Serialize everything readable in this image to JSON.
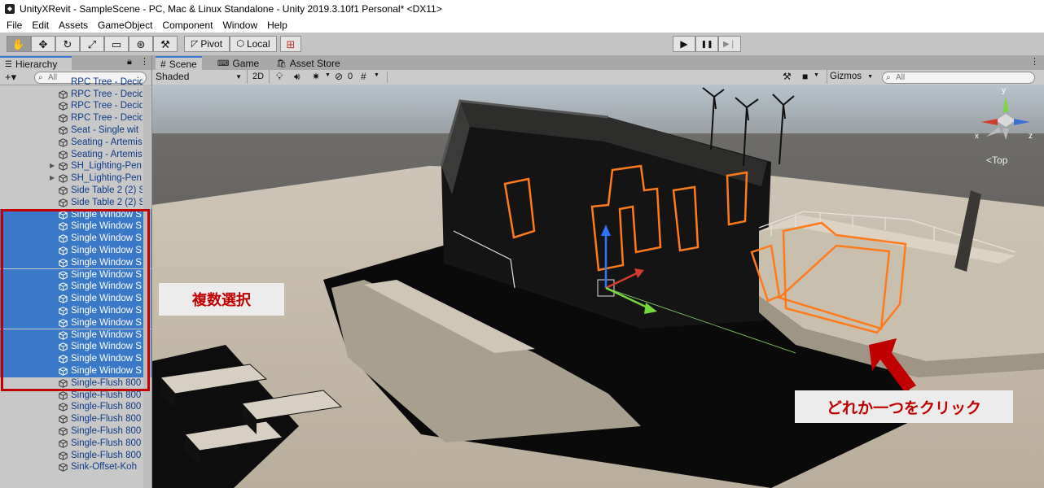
{
  "window": {
    "title": "UnityXRevit - SampleScene - PC, Mac & Linux Standalone - Unity 2019.3.10f1 Personal* <DX11>"
  },
  "menu": [
    "File",
    "Edit",
    "Assets",
    "GameObject",
    "Component",
    "Window",
    "Help"
  ],
  "toolbar": {
    "tools": [
      "hand-tool",
      "move-tool",
      "rotate-tool",
      "scale-tool",
      "rect-tool",
      "transform-tool",
      "custom-tool"
    ],
    "pivot_label": "Pivot",
    "local_label": "Local",
    "play": "▶",
    "pause": "❚❚",
    "step": "▶❘"
  },
  "hierarchy": {
    "tab_label": "Hierarchy",
    "add_label": "+▾",
    "search_placeholder": "All",
    "items": [
      {
        "label": "RPC Tree - Decid",
        "selected": false
      },
      {
        "label": "RPC Tree - Decid",
        "selected": false
      },
      {
        "label": "RPC Tree - Decid",
        "selected": false
      },
      {
        "label": "Seat - Single wit",
        "selected": false
      },
      {
        "label": "Seating - Artemis",
        "selected": false
      },
      {
        "label": "Seating - Artemis",
        "selected": false
      },
      {
        "label": "SH_Lighting-Pen",
        "selected": false,
        "expandable": true
      },
      {
        "label": "SH_Lighting-Pen",
        "selected": false,
        "expandable": true
      },
      {
        "label": "Side Table 2 (2) S",
        "selected": false
      },
      {
        "label": "Side Table 2 (2) S",
        "selected": false
      },
      {
        "label": "Single Window S",
        "selected": true
      },
      {
        "label": "Single Window S",
        "selected": true
      },
      {
        "label": "Single Window S",
        "selected": true
      },
      {
        "label": "Single Window S",
        "selected": true
      },
      {
        "label": "Single Window S",
        "selected": true
      },
      {
        "label": "Single Window S",
        "selected": true
      },
      {
        "label": "Single Window S",
        "selected": true
      },
      {
        "label": "Single Window S",
        "selected": true
      },
      {
        "label": "Single Window S",
        "selected": true
      },
      {
        "label": "Single Window S",
        "selected": true
      },
      {
        "label": "Single Window S",
        "selected": true
      },
      {
        "label": "Single Window S",
        "selected": true
      },
      {
        "label": "Single Window S",
        "selected": true
      },
      {
        "label": "Single Window S",
        "selected": true
      },
      {
        "label": "Single-Flush 800",
        "selected": false
      },
      {
        "label": "Single-Flush 800",
        "selected": false
      },
      {
        "label": "Single-Flush 800",
        "selected": false
      },
      {
        "label": "Single-Flush 800",
        "selected": false
      },
      {
        "label": "Single-Flush 800",
        "selected": false
      },
      {
        "label": "Single-Flush 800",
        "selected": false
      },
      {
        "label": "Single-Flush 800",
        "selected": false
      },
      {
        "label": "Sink-Offset-Koh",
        "selected": false
      }
    ]
  },
  "scene": {
    "tabs": [
      {
        "label": "Scene",
        "icon": "hash-icon",
        "active": true
      },
      {
        "label": "Game",
        "icon": "gamepad-icon",
        "active": false
      },
      {
        "label": "Asset Store",
        "icon": "store-icon",
        "active": false
      }
    ],
    "shading_mode": "Shaded",
    "toggle_2d": "2D",
    "hidden_count": "0",
    "gizmos_label": "Gizmos",
    "search_placeholder": "All",
    "view_label": "Top",
    "axis_labels": {
      "x": "x",
      "y": "y",
      "z": "z"
    }
  },
  "annotations": {
    "multi_select": "複数選択",
    "click_one": "どれか一つをクリック"
  },
  "colors": {
    "selection_outline": "#ff7a1a",
    "hierarchy_selection": "#3a78c8",
    "annotation_text": "#c00000",
    "annotation_box_border": "#c00000",
    "arrow": "#c00000"
  }
}
